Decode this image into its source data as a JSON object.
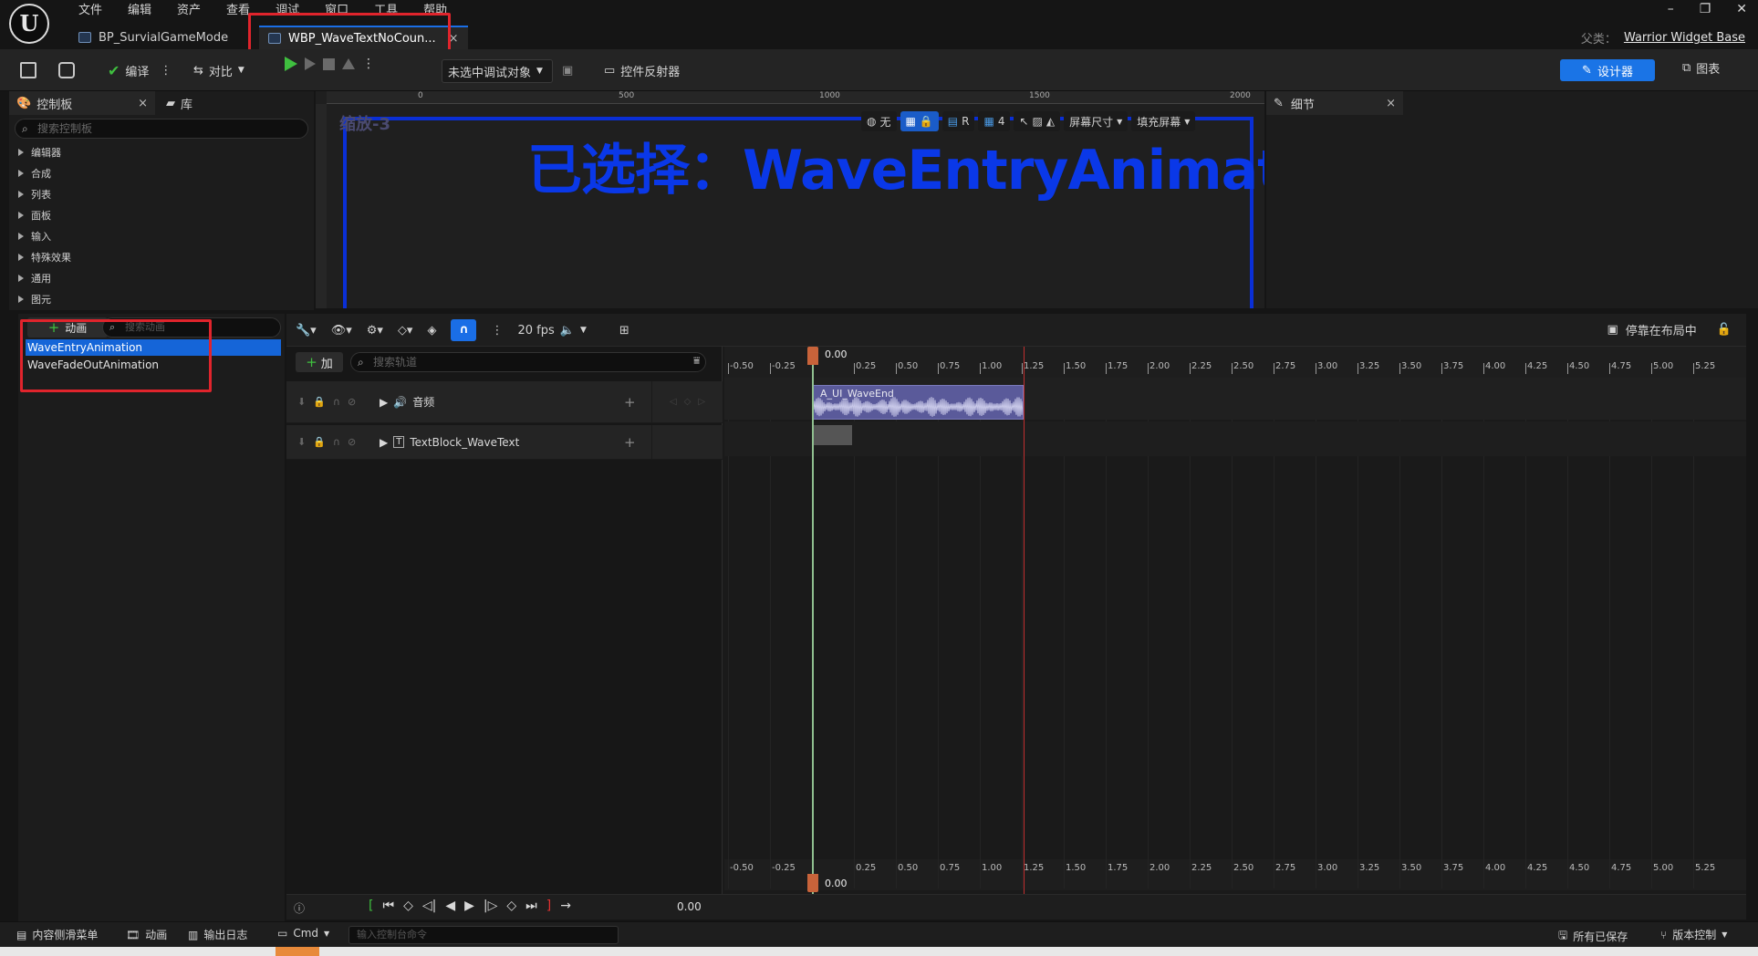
{
  "menu": [
    "文件",
    "编辑",
    "资产",
    "查看",
    "调试",
    "窗口",
    "工具",
    "帮助"
  ],
  "logo_text": "U",
  "tabs": {
    "bp": "BP_SurvialGameMode",
    "wbp": "WBP_WaveTextNoCoun...",
    "close_glyph": "×"
  },
  "parent_class": {
    "label": "父类：",
    "value": "Warrior Widget Base"
  },
  "toolbar": {
    "compile": "编译",
    "diff": "对比",
    "debug_target": "未选中调试对象",
    "widget_reflector": "控件反射器",
    "designer": "设计器",
    "graph": "图表"
  },
  "palette": {
    "tab_palette": "控制板",
    "tab_library": "库",
    "search_placeholder": "搜索控制板",
    "categories": [
      "编辑器",
      "合成",
      "列表",
      "面板",
      "输入",
      "特殊效果",
      "通用",
      "图元"
    ]
  },
  "designer": {
    "zoom": "缩放-3",
    "selected": "已选择：WaveEntryAnimation",
    "ruler_marks": [
      "0",
      "500",
      "1000",
      "1500",
      "2000"
    ],
    "tools": {
      "none": "无",
      "r": "R",
      "grid_count": "4",
      "screen_size": "屏幕尺寸",
      "fill_screen": "填充屏幕"
    }
  },
  "details": {
    "tab": "细节"
  },
  "animations": {
    "add": "动画",
    "search_placeholder": "搜索动画",
    "items": [
      "WaveEntryAnimation",
      "WaveFadeOutAnimation"
    ],
    "selected_index": 0
  },
  "sequencer": {
    "fps": "20 fps",
    "dock_layout": "停靠在布局中",
    "track_add": "加",
    "track_search_placeholder": "搜索轨道",
    "tracks": [
      {
        "label": "音频"
      },
      {
        "label": "TextBlock_WaveText"
      }
    ],
    "audio_clip": "A_UI_WaveEnd",
    "playhead_time": "0.00",
    "time_readout": "0.00",
    "ticks": [
      "-0.50",
      "-0.25",
      "0.25",
      "0.50",
      "0.75",
      "1.00",
      "1.25",
      "1.50",
      "1.75",
      "2.00",
      "2.25",
      "2.50",
      "2.75",
      "3.00",
      "3.25",
      "3.50",
      "3.75",
      "4.00",
      "4.25",
      "4.50",
      "4.75",
      "5.00",
      "5.25"
    ]
  },
  "statusbar": {
    "content_drawer": "内容侧滑菜单",
    "animation": "动画",
    "output_log": "输出日志",
    "cmd": "Cmd",
    "console_placeholder": "输入控制台命令",
    "all_saved": "所有已保存",
    "source_control": "版本控制"
  },
  "colors": {
    "accent": "#1a6ee6",
    "selected_label": "#0a38e8",
    "highlight_box": "#e0242c",
    "audio_clip": "#5a5a9a",
    "playhead": "#c8633a"
  }
}
